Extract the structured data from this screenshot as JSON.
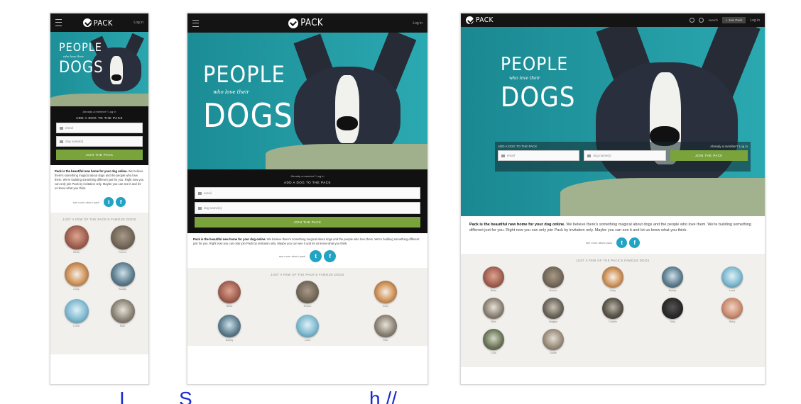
{
  "brand": {
    "name": "PACK"
  },
  "header": {
    "login": "Log in",
    "search": "search",
    "join_button": "+ Join Pack"
  },
  "hero": {
    "line1": "PEOPLE",
    "line2": "who love their",
    "line3": "DOGS"
  },
  "signup": {
    "facebook_line": "Already a member? Log in",
    "section_title": "ADD A DOG TO THE PACK",
    "email_placeholder": "email",
    "dog_placeholder": "dog name(s)",
    "join_button": "JOIN THE PACK"
  },
  "intro": {
    "lead": "Pack is the beautiful new home for your dog online.",
    "body": "We believe there's something magical about dogs and the people who love them. We're building something different just for you. Right now you can only join Pack by invitation only. Maybe you can see it and let us know what you think."
  },
  "social": {
    "more_label": "see more about pack",
    "twitter_letter": "t",
    "facebook_letter": "f"
  },
  "gallery": {
    "title": "JUST A FEW OF THE PACK'S FAMOUS DOGS",
    "pets": [
      {
        "name": "Bella"
      },
      {
        "name": "Rocco"
      },
      {
        "name": "Zoey"
      },
      {
        "name": "Buddy"
      },
      {
        "name": "Luna"
      },
      {
        "name": "Max"
      },
      {
        "name": "Maggie"
      },
      {
        "name": "Charlie"
      },
      {
        "name": "Toby"
      },
      {
        "name": "Ruby"
      },
      {
        "name": "Lola"
      },
      {
        "name": "Sadie"
      }
    ]
  },
  "caption": {
    "prefix_text": "I",
    "middle_text": "S",
    "url_text": "h        //"
  },
  "colors": {
    "topbar": "#141414",
    "hero_teal": "#1f9aa3",
    "join_green": "#7aa43b",
    "social_blue": "#23a3c3",
    "gallery_bg": "#f2f0ec",
    "caption_blue": "#1a2bd0"
  }
}
